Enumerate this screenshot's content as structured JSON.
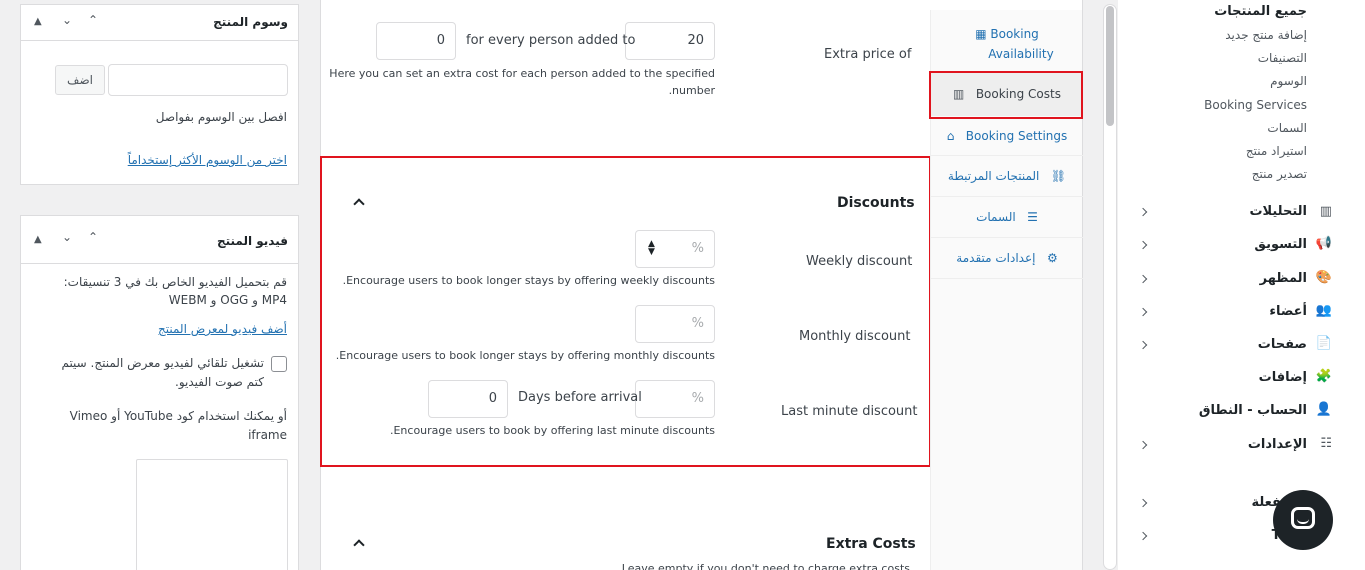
{
  "tags_box": {
    "title": "وسوم المنتج",
    "add_label": "اضف",
    "hint": "افصل بين الوسوم بفواصل",
    "link": "اختر من الوسوم الأكثر إستخداماً"
  },
  "video_box": {
    "title": "فيديو المنتج",
    "description_line1": "قم بتحميل الفيديو الخاص بك في 3 تنسيقات:",
    "description_line2": "MP4 و OGG و WEBM",
    "link": "أضف فيديو لمعرض المنتج",
    "autoplay_line1": "تشغيل تلقائي لفيديو معرض المنتج. سيتم",
    "autoplay_line2": "كتم صوت الفيديو.",
    "embed_line1": "أو يمكنك استخدام كود YouTube أو Vimeo",
    "embed_line2": "iframe"
  },
  "extra_price": {
    "label": "Extra price of",
    "amount": "20",
    "middle_text": "for every person added to",
    "persons": "0",
    "hint_line1": "Here you can set an extra cost for each person added to the specified",
    "hint_line2": ".number"
  },
  "discounts": {
    "title": "Discounts",
    "weekly_label": "Weekly discount",
    "weekly_placeholder": "%",
    "weekly_hint": ".Encourage users to book longer stays by offering weekly discounts",
    "monthly_label": "Monthly discount",
    "monthly_placeholder": "%",
    "monthly_hint": ".Encourage users to book longer stays by offering monthly discounts",
    "lastminute_label": "Last minute discount",
    "lastminute_placeholder": "%",
    "days_label": "Days before arrival",
    "days_value": "0",
    "lastminute_hint": ".Encourage users to book by offering last minute discounts"
  },
  "extra_costs": {
    "title": "Extra Costs",
    "hint": "Leave empty if you don't need to charge extra costs"
  },
  "tabs": {
    "availability_line1": "Booking",
    "availability_line2": "Availability",
    "costs": "Booking Costs",
    "settings": "Booking Settings",
    "linked": "المنتجات المرتبطة",
    "attributes": "السمات",
    "advanced": "إعدادات متقدمة"
  },
  "admin_menu": {
    "submenu": [
      "جميع المنتجات",
      "إضافة منتج جديد",
      "التصنيفات",
      "الوسوم",
      "Booking Services",
      "السمات",
      "استيراد منتج",
      "تصدير منتج"
    ],
    "items": [
      "التحليلات",
      "التسويق",
      "المظهر",
      "أعضاء",
      "صفحات",
      "إضافات",
      "الحساب - النطاق",
      "الإعدادات"
    ],
    "bottom1": "ت مفعلة",
    "bottom2": "Ti"
  },
  "colors": {
    "highlight": "#e0141e",
    "link": "#2271b1",
    "chat": "#1d2327"
  }
}
